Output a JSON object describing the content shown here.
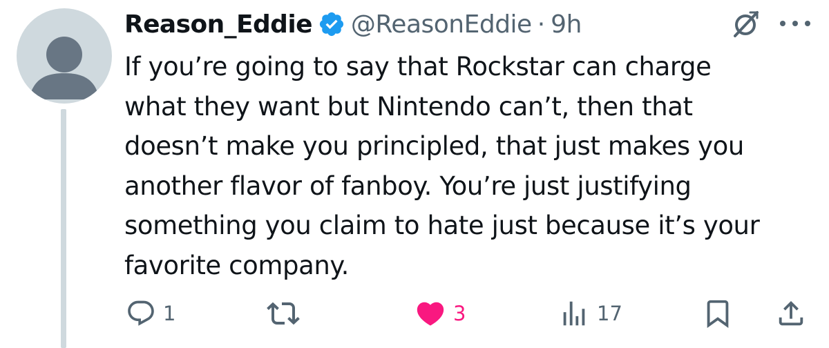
{
  "tweet": {
    "display_name": "Reason_Eddie",
    "handle": "@ReasonEddie",
    "separator": "·",
    "time": "9h",
    "text": "If you’re going to say that Rockstar can charge\nwhat they want but Nintendo can’t, then that\ndoesn’t make you principled, that just makes you\nanother flavor of fanboy. You’re just justifying\nsomething you claim to hate just because it’s your\nfavorite company."
  },
  "actions": {
    "reply_count": "1",
    "retweet_count": "",
    "like_count": "3",
    "views_count": "17"
  },
  "icons": {
    "verified": "verified-badge-icon",
    "grok": "grok-icon",
    "more": "more-icon",
    "reply": "reply-icon",
    "retweet": "retweet-icon",
    "like": "heart-icon",
    "views": "views-icon",
    "bookmark": "bookmark-icon",
    "share": "share-icon"
  },
  "colors": {
    "text": "#0f1419",
    "secondary": "#536471",
    "verified": "#1d9bf0",
    "like": "#f91880",
    "avatar_bg": "#cfd9de",
    "avatar_fg": "#687684"
  }
}
